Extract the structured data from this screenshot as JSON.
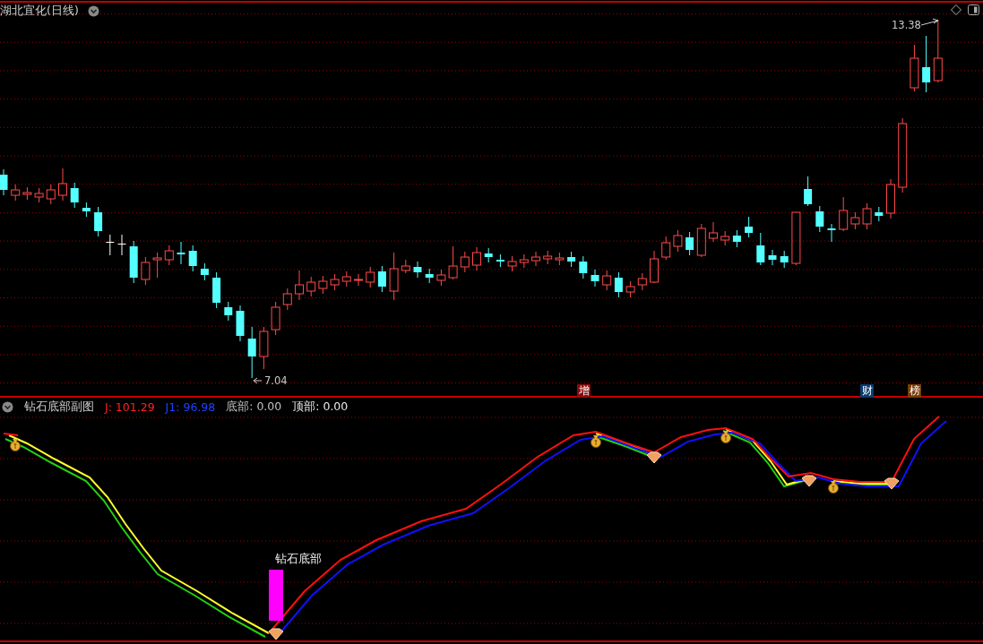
{
  "main_chart": {
    "title": "湖北宜化(日线)",
    "high_label": "13.38",
    "low_label": "7.04",
    "markers": [
      {
        "text": "增",
        "color": "#8a0c0c"
      },
      {
        "text": "财",
        "color": "#0c3a6c"
      },
      {
        "text": "榜",
        "color": "#7a3c08"
      }
    ]
  },
  "indicator": {
    "title": "钻石底部副图",
    "readings": [
      {
        "text": "J: 101.29",
        "color": "#ff2020"
      },
      {
        "text": "J1: 96.98",
        "color": "#2040ff"
      },
      {
        "text": "底部: 0.00",
        "color": "#c0c0c0"
      },
      {
        "text": "顶部: 0.00",
        "color": "#e8e8e8"
      }
    ],
    "signal_label": "钻石底部"
  }
}
